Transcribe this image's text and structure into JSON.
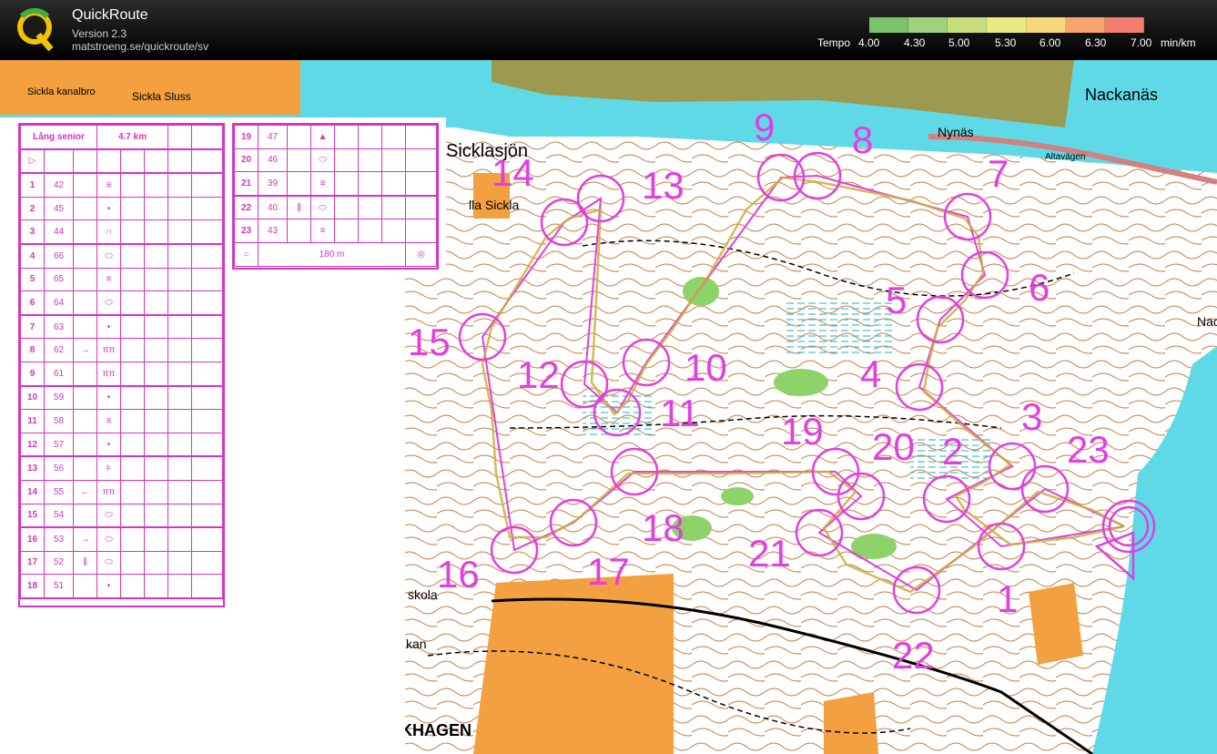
{
  "header": {
    "app_name": "QuickRoute",
    "version": "Version 2.3",
    "url": "matstroeng.se/quickroute/sv",
    "tempo_label": "Tempo",
    "tempo_ticks": [
      "4.00",
      "4.30",
      "5.00",
      "5.30",
      "6.00",
      "6.30",
      "7.00"
    ],
    "tempo_unit": "min/km",
    "tempo_colors": [
      "#7cc26b",
      "#9fd27a",
      "#c7e07d",
      "#e8ea80",
      "#f7d77a",
      "#f6a66c",
      "#f07d6e"
    ]
  },
  "map": {
    "place_names": [
      "Nackanäs",
      "Nynäs",
      "Altavägen",
      "Sickla kanalbro",
      "Sickla Sluss",
      "Sicklasjön",
      "lla Sickla",
      "skola",
      "kan",
      "KHAGEN",
      "Nacka gård"
    ],
    "control_numbers": [
      "1",
      "2",
      "3",
      "4",
      "5",
      "6",
      "7",
      "8",
      "9",
      "10",
      "11",
      "12",
      "13",
      "14",
      "15",
      "16",
      "17",
      "18",
      "19",
      "20",
      "21",
      "22",
      "23"
    ],
    "colors": {
      "water": "#5fd9e6",
      "forest": "#ffffff",
      "open": "#f7a84a",
      "urban": "#9c9a50",
      "course": "#e23ee0",
      "route": "#c8a040"
    }
  },
  "description": {
    "course_name": "Lång senior",
    "length": "4.7 km",
    "rows": [
      {
        "num": "1",
        "code": "42",
        "dir": "",
        "sym": "≡"
      },
      {
        "num": "2",
        "code": "45",
        "dir": "",
        "sym": "•"
      },
      {
        "num": "3",
        "code": "44",
        "dir": "",
        "sym": "∩"
      },
      {
        "num": "4",
        "code": "66",
        "dir": "",
        "sym": "⬭"
      },
      {
        "num": "5",
        "code": "65",
        "dir": "",
        "sym": "≡"
      },
      {
        "num": "6",
        "code": "64",
        "dir": "",
        "sym": "⬭"
      },
      {
        "num": "7",
        "code": "63",
        "dir": "",
        "sym": "•"
      },
      {
        "num": "8",
        "code": "62",
        "dir": "→",
        "sym": "ππ"
      },
      {
        "num": "9",
        "code": "61",
        "dir": "",
        "sym": "ππ"
      },
      {
        "num": "10",
        "code": "59",
        "dir": "",
        "sym": "•"
      },
      {
        "num": "11",
        "code": "58",
        "dir": "",
        "sym": "≡"
      },
      {
        "num": "12",
        "code": "57",
        "dir": "",
        "sym": "•"
      },
      {
        "num": "13",
        "code": "56",
        "dir": "",
        "sym": "⊧"
      },
      {
        "num": "14",
        "code": "55",
        "dir": "←",
        "sym": "ππ"
      },
      {
        "num": "15",
        "code": "54",
        "dir": "",
        "sym": "⬭"
      },
      {
        "num": "16",
        "code": "53",
        "dir": "→",
        "sym": "⬭"
      },
      {
        "num": "17",
        "code": "52",
        "dir": "⫼",
        "sym": "⬭"
      },
      {
        "num": "18",
        "code": "51",
        "dir": "",
        "sym": "•"
      },
      {
        "num": "19",
        "code": "47",
        "dir": "",
        "sym": "▲"
      },
      {
        "num": "20",
        "code": "46",
        "dir": "",
        "sym": "⬭"
      },
      {
        "num": "21",
        "code": "39",
        "dir": "",
        "sym": "≡"
      },
      {
        "num": "22",
        "code": "40",
        "dir": "⫼",
        "sym": "⬭"
      },
      {
        "num": "23",
        "code": "43",
        "dir": "",
        "sym": "≡"
      }
    ],
    "finish_distance": "180 m"
  }
}
